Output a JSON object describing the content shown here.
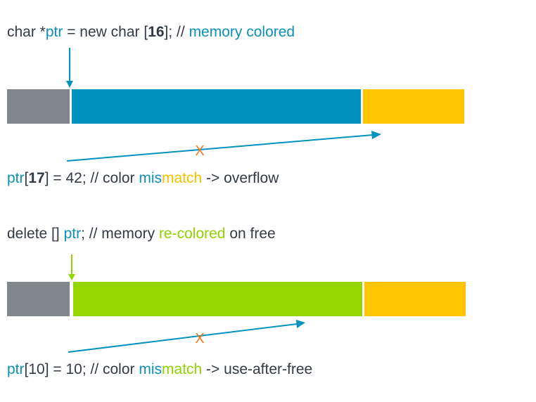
{
  "colors": {
    "text": "#333a45",
    "blue": "#0192bd",
    "gray": "#80868c",
    "yellow": "#ffc500",
    "green": "#95d600",
    "orange": "#f47820"
  },
  "panel1": {
    "code_line": {
      "p1": "char *",
      "p2": "ptr",
      "p3": " = new char [",
      "p4": "16",
      "p5": "]; // ",
      "p6": "memory colored"
    },
    "memory_segments": [
      {
        "name": "header",
        "color": "gray"
      },
      {
        "name": "allocated-16-bytes",
        "color": "blue"
      },
      {
        "name": "adjacent-memory",
        "color": "yellow"
      }
    ],
    "access_line": {
      "p1": "ptr",
      "p2": "[",
      "p3": "17",
      "p4": "] = 42; // color ",
      "p5": "mis",
      "p6": "match",
      "p7": " -> overflow"
    },
    "blocked_marker": "X"
  },
  "panel2": {
    "code_line": {
      "p1": "delete [] ",
      "p2": "ptr",
      "p3": "; // memory ",
      "p4": "re-colored",
      "p5": " on free"
    },
    "memory_segments": [
      {
        "name": "header",
        "color": "gray"
      },
      {
        "name": "freed-memory",
        "color": "green"
      },
      {
        "name": "adjacent-memory",
        "color": "yellow"
      }
    ],
    "access_line": {
      "p1": "ptr",
      "p2": "[10] = 10; // color ",
      "p3": "mis",
      "p4": "match",
      "p5": " -> use-after-free"
    },
    "blocked_marker": "X"
  }
}
